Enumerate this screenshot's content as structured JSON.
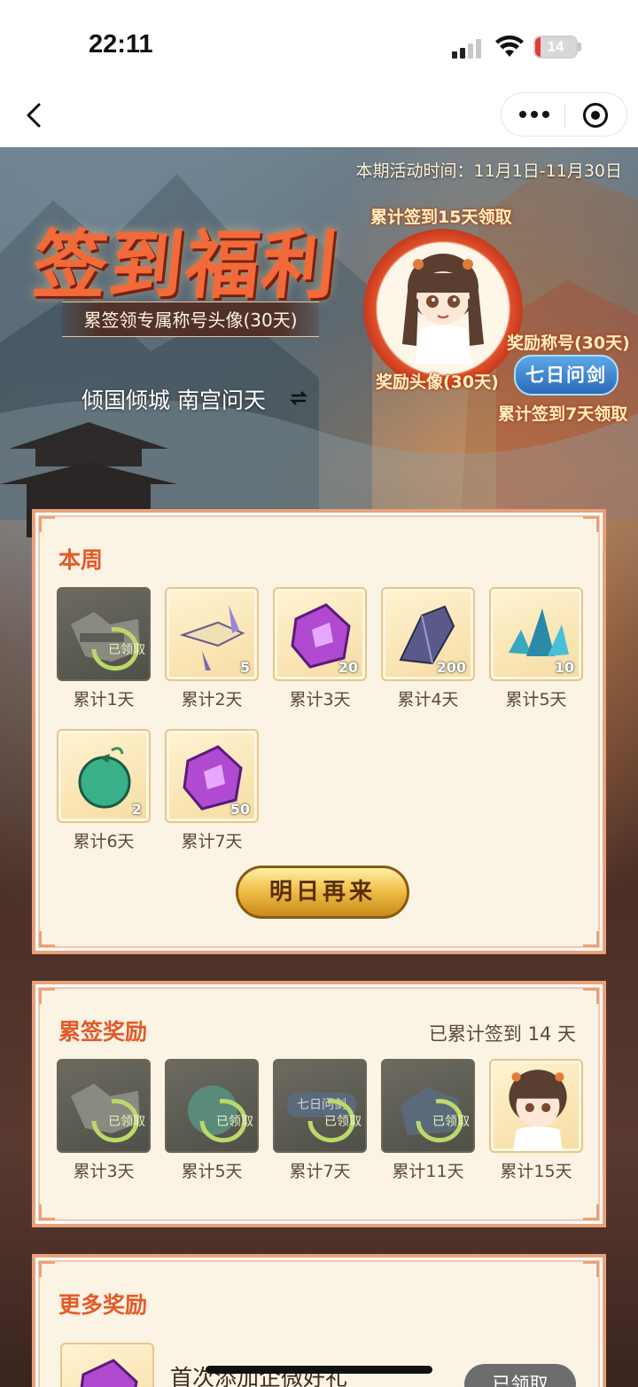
{
  "status": {
    "time": "22:11",
    "battery": "14",
    "battery_level": 0.14,
    "battery_color": "#e53935"
  },
  "nav": {
    "back_icon": "chevron-left-icon",
    "more_icon": "more-dots-icon",
    "close_icon": "target-close-icon"
  },
  "banner": {
    "period": "本期活动时间：11月1日-11月30日",
    "title": "签到福利",
    "subtitle": "累签领专属称号头像(30天)",
    "player": "倾国倾城 南宫问天",
    "avatar_top_label": "累计签到15天领取",
    "avatar_label": "奖励头像(30天)",
    "title_label": "奖励称号(30天)",
    "title_badge": "七日问剑",
    "title_bottom_label": "累计签到7天领取"
  },
  "week": {
    "title": "本周",
    "items": [
      {
        "caption": "累计1天",
        "qty": "",
        "claimed": true,
        "stamp": "已领取",
        "icon": "gear-parts-icon"
      },
      {
        "caption": "累计2天",
        "qty": "5",
        "claimed": false,
        "icon": "scroll-weapon-icon"
      },
      {
        "caption": "累计3天",
        "qty": "20",
        "claimed": false,
        "icon": "purple-rune-icon"
      },
      {
        "caption": "累计4天",
        "qty": "200",
        "claimed": false,
        "icon": "dark-crystal-icon"
      },
      {
        "caption": "累计5天",
        "qty": "10",
        "claimed": false,
        "icon": "blue-crystal-icon"
      },
      {
        "caption": "累计6天",
        "qty": "2",
        "claimed": false,
        "icon": "green-pouch-icon"
      },
      {
        "caption": "累计7天",
        "qty": "50",
        "claimed": false,
        "icon": "purple-rune-icon"
      }
    ],
    "button": "明日再来"
  },
  "cumulative": {
    "title": "累签奖励",
    "summary": "已累计签到 14 天",
    "items": [
      {
        "caption": "累计3天",
        "claimed": true,
        "stamp": "已领取",
        "icon": "gear-parts-icon"
      },
      {
        "caption": "累计5天",
        "claimed": true,
        "stamp": "已领取",
        "icon": "green-pouch-icon"
      },
      {
        "caption": "累计7天",
        "claimed": true,
        "stamp": "已领取",
        "icon": "title-badge-icon",
        "badge_text": "七日问剑"
      },
      {
        "caption": "累计11天",
        "claimed": true,
        "stamp": "已领取",
        "icon": "chest-icon"
      },
      {
        "caption": "累计15天",
        "claimed": false,
        "icon": "avatar-portrait-icon"
      }
    ]
  },
  "more": {
    "title": "更多奖励",
    "first_item_text": "首次添加企微好礼",
    "first_item_button": "已领取"
  },
  "colors": {
    "accent": "#e35a2a",
    "card_border": "#e8a27a",
    "card_bg": "#fbf3e4",
    "badge_blue": "#2c6ab8"
  }
}
